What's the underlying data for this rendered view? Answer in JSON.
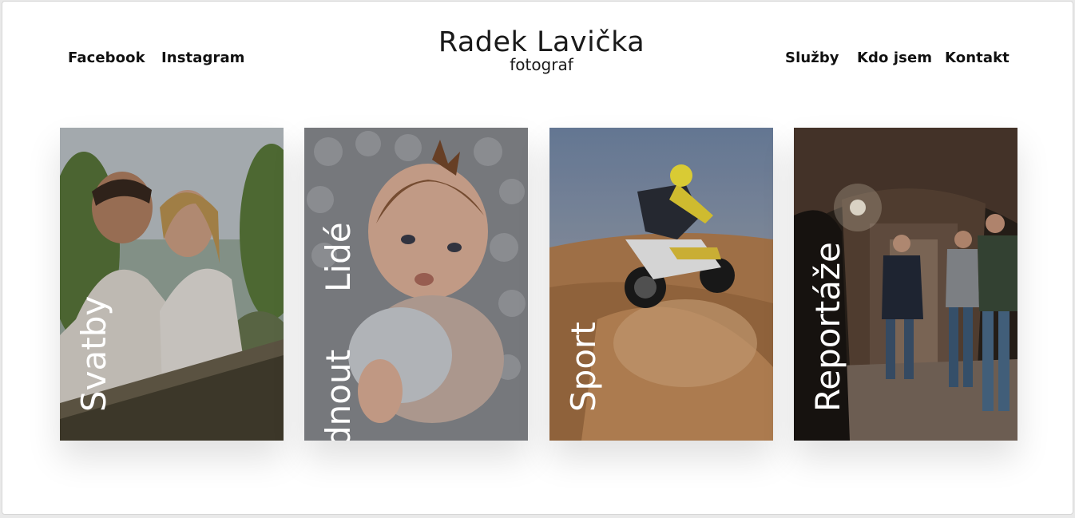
{
  "header": {
    "social": {
      "facebook": "Facebook",
      "instagram": "Instagram"
    },
    "logo": {
      "name": "Radek Lavička",
      "subtitle": "fotograf"
    },
    "menu": {
      "sluzby": "Služby",
      "kdo_jsem": "Kdo jsem",
      "kontakt": "Kontakt"
    }
  },
  "cards": [
    {
      "label": "Svatby"
    },
    {
      "label": "Lidé",
      "secondary_label": "dnout"
    },
    {
      "label": "Sport"
    },
    {
      "label": "Reportáže"
    }
  ]
}
